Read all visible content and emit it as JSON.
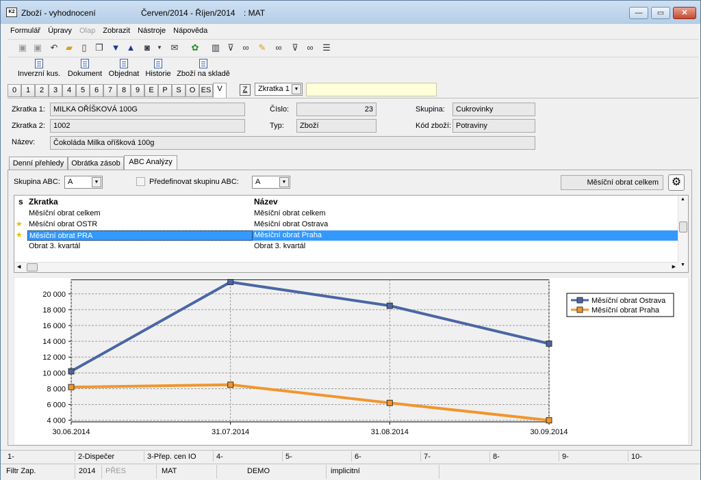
{
  "window": {
    "title": "Zboží - vyhodnocení",
    "period": "Červen/2014  - Říjen/2014",
    "db": ": MAT",
    "app_icon": "K2"
  },
  "window_controls": {
    "minimize": "—",
    "maximize": "▭",
    "close": "✕"
  },
  "menu": [
    "Formulář",
    "Úpravy",
    "Olap",
    "Zobrazit",
    "Nástroje",
    "Nápověda"
  ],
  "toolbar_icons": [
    "save-icon",
    "save-all-icon",
    "undo-icon",
    "open-folder-icon",
    "new-doc-icon",
    "copy-doc-icon",
    "arrow-down-icon",
    "arrow-up-icon",
    "camera-icon",
    "dropdown-arrow-icon",
    "mail-icon",
    "tree-icon",
    "book-icon",
    "filter-icon",
    "binoculars-icon",
    "edit-folder-icon",
    "binoculars-next-icon",
    "filter-doc-icon",
    "binoculars-clear-icon",
    "menu-icon"
  ],
  "buttons": [
    "Inverzní kus.",
    "Dokument",
    "Objednat",
    "Historie",
    "Zboží na skladě"
  ],
  "page_tabs": [
    "0",
    "1",
    "2",
    "3",
    "4",
    "5",
    "6",
    "7",
    "8",
    "9",
    "E",
    "P",
    "S",
    "O",
    "ES",
    "V"
  ],
  "z_button": "Z",
  "sort_combo": "Zkratka 1",
  "form": {
    "zkratka1_label": "Zkratka 1:",
    "zkratka1": "MILKA OŘÍŠKOVÁ 100G",
    "zkratka2_label": "Zkratka 2:",
    "zkratka2": "1002",
    "nazev_label": "Název:",
    "nazev": "Čokoláda Milka oříšková 100g",
    "cislo_label": "Číslo:",
    "cislo": "23",
    "typ_label": "Typ:",
    "typ": "Zboží",
    "skupina_label": "Skupina:",
    "skupina": "Cukrovinky",
    "kod_label": "Kód zboží:",
    "kod": "Potraviny"
  },
  "sub_tabs": [
    "Denní přehledy",
    "Obrátka zásob",
    "ABC Analýzy"
  ],
  "abc": {
    "skupina_label": "Skupina ABC:",
    "skupina_value": "A",
    "predef_label": "Předefinovat skupinu ABC:",
    "predef_value": "A",
    "selected_label": "Měsíční obrat celkem"
  },
  "table": {
    "headers": [
      "s",
      "Zkratka",
      "Název"
    ],
    "rows": [
      {
        "star": "",
        "zkratka": "Měsíční obrat celkem",
        "nazev": "Měsíční obrat celkem"
      },
      {
        "star": "★",
        "zkratka": "Měsíční obrat OSTR",
        "nazev": "Měsíční obrat Ostrava"
      },
      {
        "star": "★",
        "zkratka": "Měsíční obrat PRA",
        "nazev": "Měsíční obrat Praha"
      },
      {
        "star": "",
        "zkratka": "Obrat 3. kvartál",
        "nazev": "Obrat 3. kvartál"
      }
    ]
  },
  "chart_data": {
    "type": "line",
    "x": [
      "30.06.2014",
      "31.07.2014",
      "31.08.2014",
      "30.09.2014"
    ],
    "yticks": [
      "4 000",
      "6 000",
      "8 000",
      "10 000",
      "12 000",
      "14 000",
      "16 000",
      "18 000",
      "20 000"
    ],
    "ylim": [
      3800,
      21800
    ],
    "series": [
      {
        "name": "Měsíční obrat Ostrava",
        "color": "#4a66a4",
        "values": [
          10200,
          21500,
          18500,
          13700
        ]
      },
      {
        "name": "Měsíční obrat Praha",
        "color": "#f0962e",
        "values": [
          8200,
          8500,
          6200,
          4000
        ]
      }
    ],
    "legend": "top-right",
    "grid": true
  },
  "status1": [
    "1-",
    "2-Dispečer",
    "3-Přep. cen IO",
    "4-",
    "5-",
    "6-",
    "7-",
    "8-",
    "9-",
    "10-"
  ],
  "status2": [
    "Filtr Zap.",
    "2014",
    "PŘES",
    "MAT",
    "DEMO",
    "implicitní"
  ]
}
